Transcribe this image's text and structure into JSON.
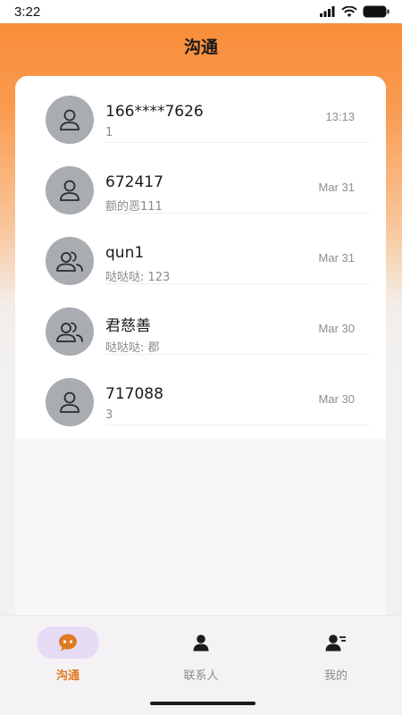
{
  "status_bar": {
    "time": "3:22"
  },
  "header": {
    "title": "沟通"
  },
  "conversations": [
    {
      "name": "166****7626",
      "message": "1",
      "time": "13:13",
      "avatar": "person-icon"
    },
    {
      "name": "672417",
      "message": "额的恶111",
      "time": "Mar 31",
      "avatar": "person-icon"
    },
    {
      "name": "qun1",
      "message": "哒哒哒: 123",
      "time": "Mar 31",
      "avatar": "group-icon"
    },
    {
      "name": "君慈善",
      "message": "哒哒哒: 郡",
      "time": "Mar 30",
      "avatar": "group-icon"
    },
    {
      "name": "717088",
      "message": "3",
      "time": "Mar 30",
      "avatar": "person-icon"
    }
  ],
  "tabs": [
    {
      "label": "沟通",
      "icon": "chat-bubble-icon",
      "active": true
    },
    {
      "label": "联系人",
      "icon": "contact-icon",
      "active": false
    },
    {
      "label": "我的",
      "icon": "profile-icon",
      "active": false
    }
  ],
  "colors": {
    "accent": "#e07a22",
    "active_pill": "#e6dcf5",
    "inactive_tab": "#8c8c8c",
    "header_gradient_top": "#f88a35"
  }
}
